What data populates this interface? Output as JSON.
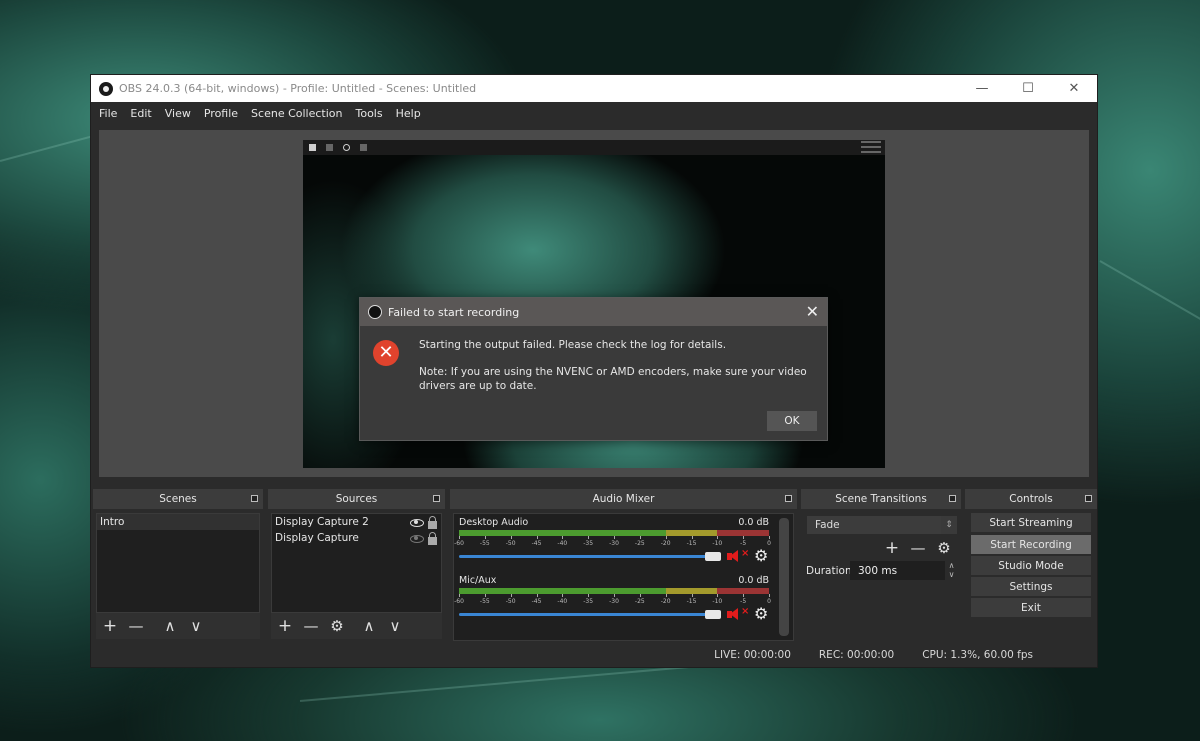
{
  "window": {
    "title": "OBS 24.0.3 (64-bit, windows) - Profile: Untitled - Scenes: Untitled",
    "controls": {
      "minimize": "—",
      "maximize": "☐",
      "close": "✕"
    }
  },
  "menu": [
    "File",
    "Edit",
    "View",
    "Profile",
    "Scene Collection",
    "Tools",
    "Help"
  ],
  "dialog": {
    "title": "Failed to start recording",
    "close_icon": "✕",
    "error_icon": "✕",
    "message": "Starting the output failed. Please check the log for details.",
    "note": "Note: If you are using the NVENC or AMD encoders, make sure your video drivers are up to date.",
    "ok_label": "OK"
  },
  "scenes": {
    "title": "Scenes",
    "items": [
      {
        "name": "Intro",
        "selected": true
      }
    ],
    "toolbar": {
      "add": "+",
      "remove": "—",
      "up": "∧",
      "down": "∨"
    }
  },
  "sources": {
    "title": "Sources",
    "items": [
      {
        "name": "Display Capture 2",
        "visible": true,
        "locked": false
      },
      {
        "name": "Display Capture",
        "visible": false,
        "locked": false
      }
    ],
    "toolbar": {
      "add": "+",
      "remove": "—",
      "settings": "⚙",
      "up": "∧",
      "down": "∨"
    }
  },
  "audio_mixer": {
    "title": "Audio Mixer",
    "meter_scale": [
      "-60",
      "-55",
      "-50",
      "-45",
      "-40",
      "-35",
      "-30",
      "-25",
      "-20",
      "-15",
      "-10",
      "-5",
      "0"
    ],
    "channels": [
      {
        "name": "Desktop Audio",
        "level": "0.0 dB",
        "volume": 1.0,
        "muted": true,
        "mute_x": "×",
        "gear": "⚙"
      },
      {
        "name": "Mic/Aux",
        "level": "0.0 dB",
        "volume": 1.0,
        "muted": true,
        "mute_x": "×",
        "gear": "⚙"
      }
    ]
  },
  "scene_transitions": {
    "title": "Scene Transitions",
    "selected": "Fade",
    "spin": "⇕",
    "toolbar": {
      "add": "+",
      "remove": "—",
      "settings": "⚙"
    },
    "duration_label": "Duration",
    "duration_value": "300 ms",
    "duration_spin_up": "∧",
    "duration_spin_down": "∨"
  },
  "controls": {
    "title": "Controls",
    "buttons": [
      "Start Streaming",
      "Start Recording",
      "Studio Mode",
      "Settings",
      "Exit"
    ],
    "active": "Start Recording"
  },
  "status": {
    "live": "LIVE: 00:00:00",
    "rec": "REC: 00:00:00",
    "cpu": "CPU: 1.3%, 60.00 fps"
  }
}
